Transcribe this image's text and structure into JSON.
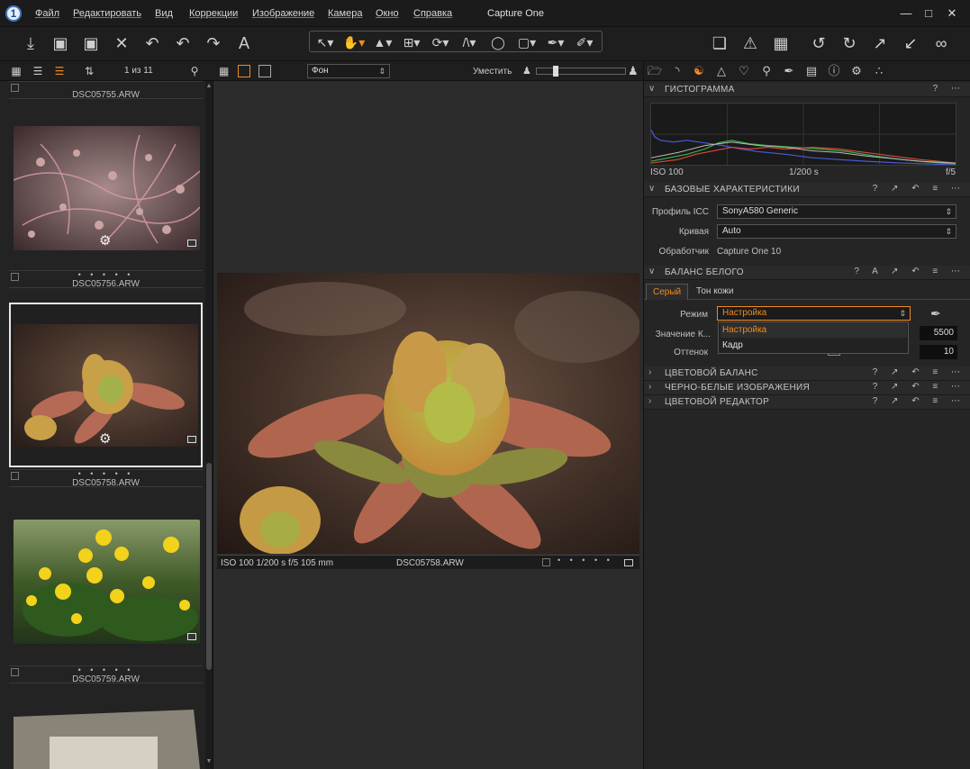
{
  "window": {
    "title": "Capture One"
  },
  "menu": [
    "Файл",
    "Редактировать",
    "Вид",
    "Коррекции",
    "Изображение",
    "Камера",
    "Окно",
    "Справка"
  ],
  "browser": {
    "counter": "1 из 11",
    "thumbs": [
      {
        "name": "DSC05755.ARW",
        "stars": "• • • • •"
      },
      {
        "name": "DSC05756.ARW",
        "stars": "• • • • •"
      },
      {
        "name": "DSC05758.ARW",
        "stars": "• • • • •",
        "selected": true
      },
      {
        "name": "DSC05759.ARW",
        "stars": "• • • • •"
      }
    ]
  },
  "viewer": {
    "background_select": "Фон",
    "fit_label": "Уместить",
    "exif": "ISO 100  1/200 s  f/5  105 mm",
    "filename": "DSC05758.ARW",
    "stars": "• • • • •"
  },
  "tools": {
    "histogram": {
      "title": "ГИСТОГРАММА",
      "iso": "ISO 100",
      "shutter": "1/200 s",
      "aperture": "f/5"
    },
    "base": {
      "title": "БАЗОВЫЕ ХАРАКТЕРИСТИКИ",
      "icc_label": "Профиль ICC",
      "icc_value": "SonyA580 Generic",
      "curve_label": "Кривая",
      "curve_value": "Auto",
      "engine_label": "Обработчик",
      "engine_value": "Capture One 10"
    },
    "white_balance": {
      "title": "БАЛАНС БЕЛОГО",
      "tab_gray": "Серый",
      "tab_skin": "Тон кожи",
      "mode_label": "Режим",
      "mode_value": "Настройка",
      "kelvin_label": "Значение К...",
      "kelvin_value": "5500",
      "tint_label": "Оттенок",
      "tint_value": "10",
      "dropdown": [
        "Настройка",
        "Кадр"
      ]
    },
    "collapsed": [
      "ЦВЕТОВОЙ БАЛАНС",
      "ЧЕРНО-БЕЛЫЕ ИЗОБРАЖЕНИЯ",
      "ЦВЕТОВОЙ РЕДАКТОР"
    ],
    "accent_color": "#f08a24"
  }
}
